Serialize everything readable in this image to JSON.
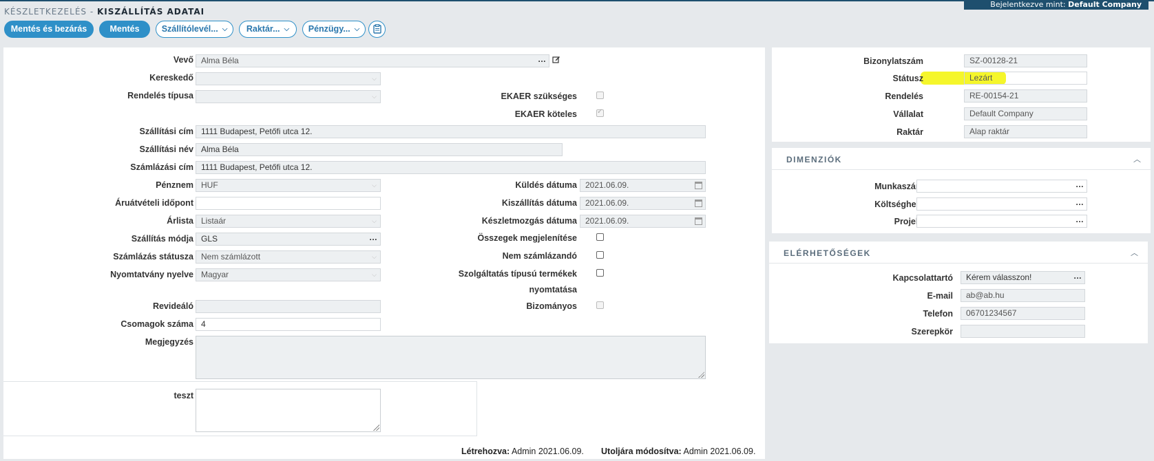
{
  "header": {
    "breadcrumb_parent": "KÉSZLETKEZELÉS -",
    "breadcrumb_current": "KISZÁLLÍTÁS ADATAI",
    "logged_in_label": "Bejelentkezve mint:",
    "logged_in_user": "Default Company"
  },
  "toolbar": {
    "save_close": "Mentés és bezárás",
    "save": "Mentés",
    "delivery_note": "Szállítólevél...",
    "warehouse": "Raktár...",
    "finance": "Pénzügy..."
  },
  "icons": {
    "edit": "edit-icon",
    "clipboard": "clipboard-icon",
    "calendar": "calendar-icon",
    "chevron_down": "chevron-down-icon",
    "chevron_up": "chevron-up-icon"
  },
  "main": {
    "customer": {
      "label": "Vevő",
      "value": "Alma Béla"
    },
    "merchant": {
      "label": "Kereskedő",
      "value": ""
    },
    "order_type": {
      "label": "Rendelés típusa",
      "value": ""
    },
    "ekaer_needed": {
      "label": "EKAER szükséges",
      "checked": false
    },
    "ekaer_required": {
      "label": "EKAER köteles",
      "checked": true
    },
    "ship_address": {
      "label": "Szállítási cím",
      "value": "1111 Budapest, Petőfi utca 12."
    },
    "ship_name": {
      "label": "Szállítási név",
      "value": "Alma Béla"
    },
    "bill_address": {
      "label": "Számlázási cím",
      "value": "1111 Budapest, Petőfi utca 12."
    },
    "currency": {
      "label": "Pénznem",
      "value": "HUF"
    },
    "pickup_time": {
      "label": "Áruátvételi időpont",
      "value": ""
    },
    "price_list": {
      "label": "Árlista",
      "value": "Listaár"
    },
    "ship_mode": {
      "label": "Szállítás módja",
      "value": "GLS"
    },
    "bill_status": {
      "label": "Számlázás státusza",
      "value": "Nem számlázott"
    },
    "print_lang": {
      "label": "Nyomtatvány nyelve",
      "value": "Magyar"
    },
    "auditor": {
      "label": "Revideáló",
      "value": ""
    },
    "packages": {
      "label": "Csomagok száma",
      "value": "4"
    },
    "note": {
      "label": "Megjegyzés",
      "value": ""
    },
    "send_date": {
      "label": "Küldés dátuma",
      "value": "2021.06.09."
    },
    "delivery_date": {
      "label": "Kiszállítás dátuma",
      "value": "2021.06.09."
    },
    "stock_date": {
      "label": "Készletmozgás dátuma",
      "value": "2021.06.09."
    },
    "show_totals": {
      "label": "Összegek megjelenítése",
      "checked": false
    },
    "not_billable": {
      "label": "Nem számlázandó",
      "checked": false
    },
    "service_print_l1": "Szolgáltatás típusú termékek",
    "service_print_l2": "nyomtatása",
    "consignment": {
      "label": "Bizományos",
      "checked": false
    },
    "test": {
      "label": "teszt",
      "value": ""
    },
    "created_label": "Létrehozva:",
    "created_value": "Admin 2021.06.09.",
    "modified_label": "Utoljára módosítva:",
    "modified_value": "Admin 2021.06.09."
  },
  "doc": {
    "doc_no": {
      "label": "Bizonylatszám",
      "value": "SZ-00128-21"
    },
    "status": {
      "label": "Státusz",
      "value": "Lezárt"
    },
    "order": {
      "label": "Rendelés",
      "value": "RE-00154-21"
    },
    "company": {
      "label": "Vállalat",
      "value": "Default Company"
    },
    "warehouse": {
      "label": "Raktár",
      "value": "Alap raktár"
    }
  },
  "dimensions": {
    "title": "DIMENZIÓK",
    "worknum": {
      "label": "Munkaszám",
      "value": ""
    },
    "costcenter": {
      "label": "Költséghely",
      "value": ""
    },
    "project": {
      "label": "Projekt",
      "value": ""
    }
  },
  "contacts": {
    "title": "ELÉRHETŐSÉGEK",
    "contact": {
      "label": "Kapcsolattartó",
      "value": "Kérem válasszon!"
    },
    "email": {
      "label": "E-mail",
      "value": "ab@ab.hu"
    },
    "phone": {
      "label": "Telefon",
      "value": "06701234567"
    },
    "role": {
      "label": "Szerepkör",
      "value": ""
    }
  },
  "colors": {
    "accent": "#2f90c8",
    "navy": "#1e4f6e",
    "highlight": "#f4f514"
  }
}
